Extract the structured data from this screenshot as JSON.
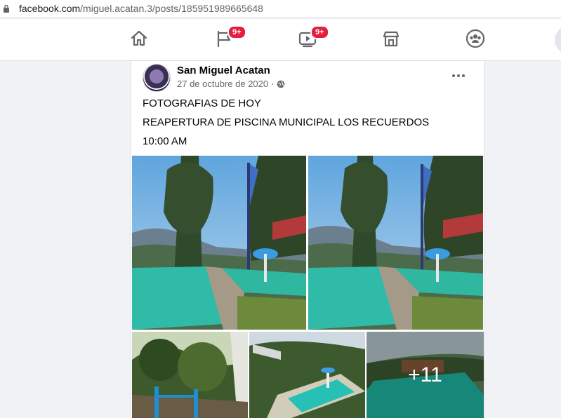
{
  "browser": {
    "url_domain": "facebook.com",
    "url_path": "/miguel.acatan.3/posts/185951989665648"
  },
  "nav": {
    "items": [
      {
        "icon": "home-icon"
      },
      {
        "icon": "flag-icon",
        "badge": "9+"
      },
      {
        "icon": "watch-icon",
        "badge": "9+"
      },
      {
        "icon": "marketplace-icon"
      },
      {
        "icon": "groups-icon"
      }
    ]
  },
  "post": {
    "author": "San Miguel Acatan",
    "date": "27 de octubre de 2020",
    "privacy_icon": "globe-icon",
    "lines": [
      "FOTOGRAFIAS DE HOY",
      "REAPERTURA DE PISCINA MUNICIPAL LOS RECUERDOS",
      "10:00 AM"
    ],
    "more_photos": "+11"
  },
  "colors": {
    "badge": "#e41e3f",
    "water": "#1fb5a3",
    "sky": "#7fb6e0"
  }
}
